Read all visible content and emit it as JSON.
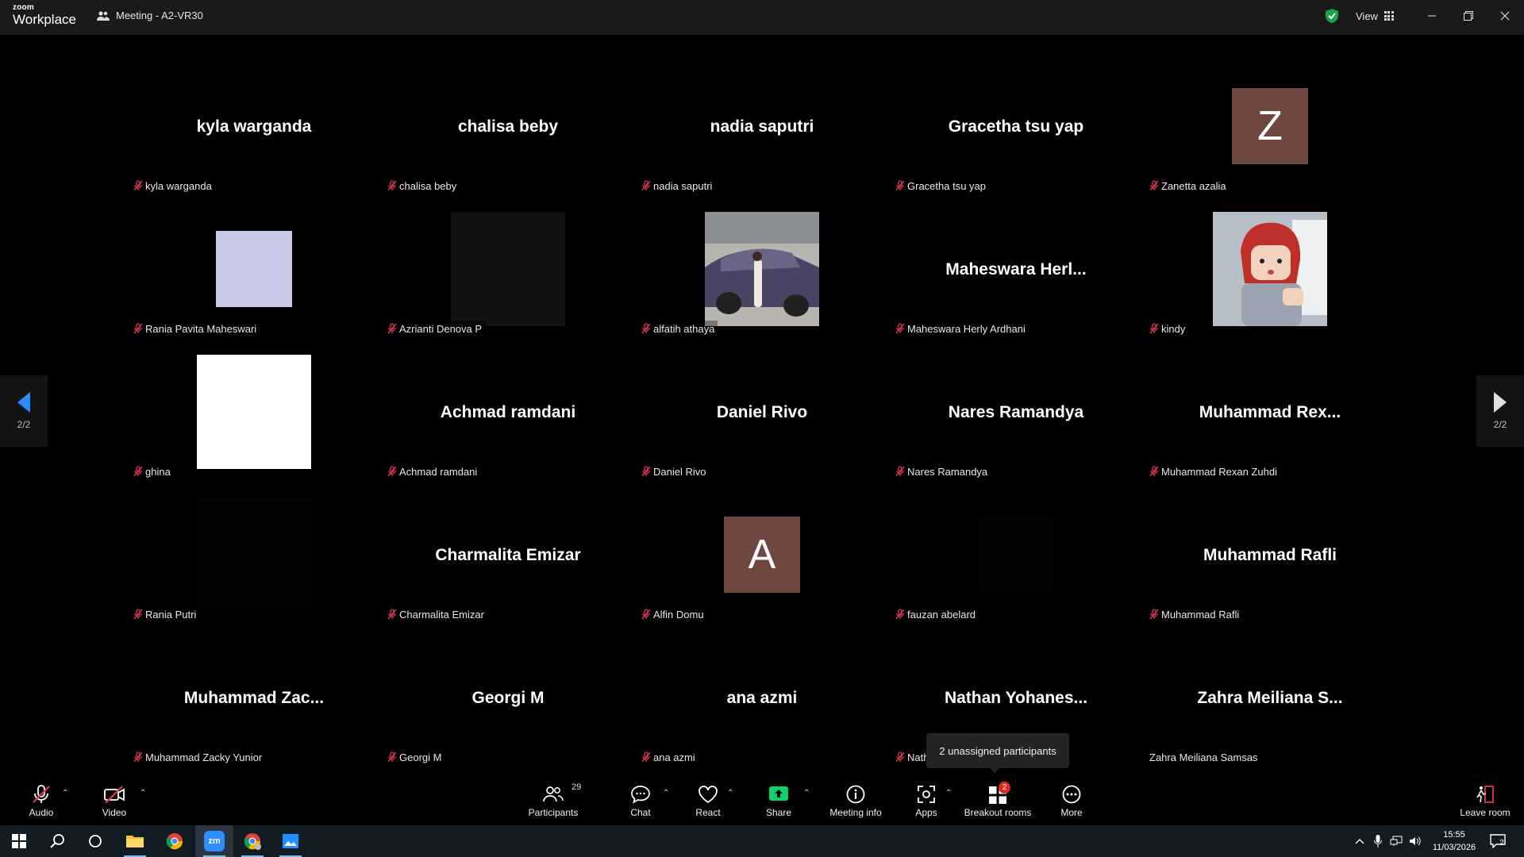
{
  "titlebar": {
    "logo_top": "zoom",
    "logo_bottom": "Workplace",
    "meeting_title": "Meeting - A2-VR30",
    "view_label": "View"
  },
  "colors": {
    "accent_green": "#0bd369",
    "secure_green": "#1aa34a",
    "muted_red": "#e0384a",
    "nav_blue": "#2d8cff",
    "avatar_brown": "#6e4840"
  },
  "participants": [
    {
      "name": "kyla warganda",
      "display": "kyla warganda",
      "muted": true,
      "tile": "name"
    },
    {
      "name": "chalisa beby",
      "display": "chalisa beby",
      "muted": true,
      "tile": "name"
    },
    {
      "name": "nadia saputri",
      "display": "nadia saputri",
      "muted": true,
      "tile": "name"
    },
    {
      "name": "Gracetha tsu yap",
      "display": "Gracetha tsu yap",
      "muted": true,
      "tile": "name"
    },
    {
      "name": "Zanetta azalia",
      "display": "Z",
      "muted": true,
      "tile": "letter"
    },
    {
      "name": "Rania Pavita Maheswari",
      "display": "",
      "muted": true,
      "tile": "lavender-photo"
    },
    {
      "name": "Azrianti Denova P",
      "display": "",
      "muted": true,
      "tile": "dark-photo"
    },
    {
      "name": "alfatih athaya",
      "display": "",
      "muted": true,
      "tile": "car-photo"
    },
    {
      "name": "Maheswara Herly Ardhani",
      "display": "Maheswara  Herl...",
      "muted": true,
      "tile": "name"
    },
    {
      "name": "kindy",
      "display": "",
      "muted": true,
      "tile": "avatar-photo"
    },
    {
      "name": "ghina",
      "display": "",
      "muted": true,
      "tile": "white-photo"
    },
    {
      "name": "Achmad ramdani",
      "display": "Achmad ramdani",
      "muted": true,
      "tile": "name"
    },
    {
      "name": "Daniel Rivo",
      "display": "Daniel Rivo",
      "muted": true,
      "tile": "name"
    },
    {
      "name": "Nares Ramandya",
      "display": "Nares Ramandya",
      "muted": true,
      "tile": "name"
    },
    {
      "name": "Muhammad Rexan Zuhdi",
      "display": "Muhammad  Rex...",
      "muted": true,
      "tile": "name"
    },
    {
      "name": "Rania Putri",
      "display": "",
      "muted": true,
      "tile": "black-photo"
    },
    {
      "name": "Charmalita Emizar",
      "display": "Charmalita Emizar",
      "muted": true,
      "tile": "name"
    },
    {
      "name": "Alfin Domu",
      "display": "A",
      "muted": true,
      "tile": "letter"
    },
    {
      "name": "fauzan abelard",
      "display": "",
      "muted": true,
      "tile": "small-black-photo"
    },
    {
      "name": "Muhammad Rafli",
      "display": "Muhammad Rafli",
      "muted": true,
      "tile": "name"
    },
    {
      "name": "Muhammad Zacky Yunior",
      "display": "Muhammad  Zac...",
      "muted": true,
      "tile": "name"
    },
    {
      "name": "Georgi M",
      "display": "Georgi M",
      "muted": true,
      "tile": "name"
    },
    {
      "name": "ana azmi",
      "display": "ana azmi",
      "muted": true,
      "tile": "name"
    },
    {
      "name": "Nath",
      "display": "Nathan  Yohanes...",
      "muted": true,
      "tile": "name"
    },
    {
      "name": "Zahra Meiliana Samsas",
      "display": "Zahra Meiliana S...",
      "muted": false,
      "tile": "name"
    }
  ],
  "pagination": {
    "left": "2/2",
    "right": "2/2"
  },
  "tooltip": "2 unassigned participants",
  "toolbar": {
    "audio": "Audio",
    "video": "Video",
    "participants": "Participants",
    "participants_count": "29",
    "chat": "Chat",
    "react": "React",
    "share": "Share",
    "meeting_info": "Meeting info",
    "apps": "Apps",
    "breakout_rooms": "Breakout rooms",
    "breakout_badge": "2",
    "more": "More",
    "leave_room": "Leave room"
  },
  "taskbar": {
    "time": "15:55",
    "date": "11/03/2026",
    "notifications": "2",
    "zoom_icon": "zm"
  }
}
